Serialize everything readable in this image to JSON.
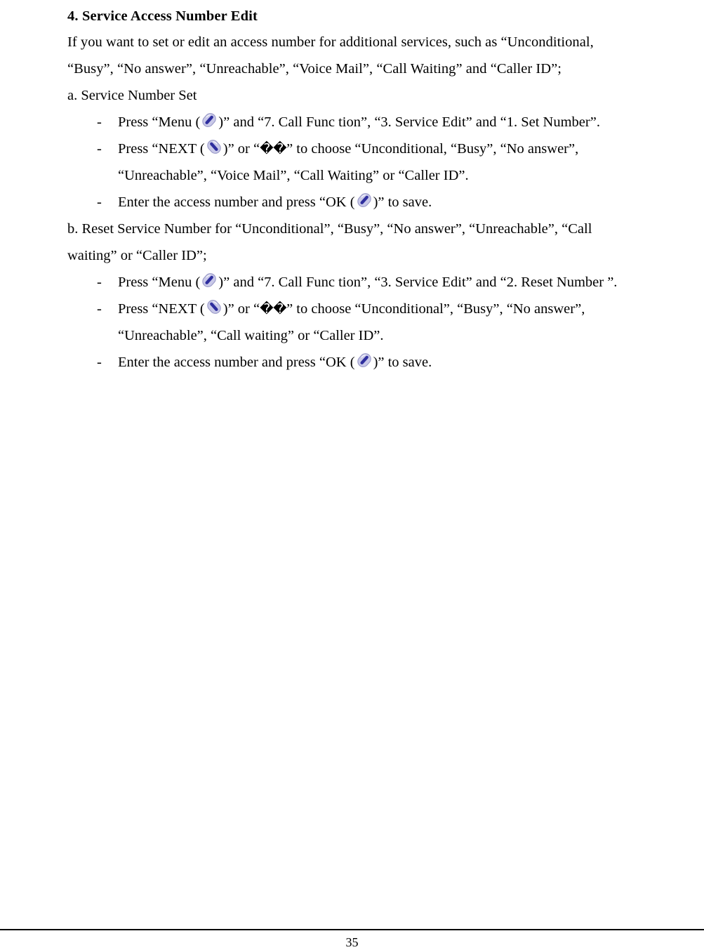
{
  "document": {
    "heading": "4. Service Access Number Edit",
    "intro": {
      "line1": "If you want to set or edit an access number for additional services, such as  “Unconditional,",
      "line2": "“Busy”, “No answer”, “Unreachable”, “Voice Mail”, “Call Waiting” and “Caller ID”;"
    },
    "section_a": {
      "subhead": "a. Service Number Set",
      "items": [
        {
          "dash": "-",
          "before_icon": "Press “Menu (",
          "icon": "softkey-left-icon",
          "after_icon": ")” and “7. Call Func tion”, “3. Service Edit” and “1. Set Number”."
        },
        {
          "dash": "-",
          "before_icon": "Press “NEXT (",
          "icon": "softkey-right-icon",
          "after_icon": ")” or “",
          "missing_glyphs": "��",
          "after_glyphs": "” to choose  “Unconditional, “Busy”, “No answer”,",
          "continuation": "“Unreachable”, “Voice Mail”, “Call Waiting” or “Caller ID”."
        },
        {
          "dash": "-",
          "before_icon": "Enter the access number and press “OK (",
          "icon": "softkey-left-icon",
          "after_icon": ")” to save."
        }
      ]
    },
    "section_b": {
      "subhead_line1": "b. Reset Service Number for “Unconditional”, “Busy”, “No answer”, “Unreachable”, “Call",
      "subhead_line2": "waiting”  or “Caller ID”;",
      "items": [
        {
          "dash": "-",
          "before_icon": "Press “Menu (",
          "icon": "softkey-left-icon",
          "after_icon": ")” and “7. Call Func tion”, “3. Service Edit” and “2. Reset Number ”."
        },
        {
          "dash": "-",
          "before_icon": "Press “NEXT (",
          "icon": "softkey-right-icon",
          "after_icon": ")” or “",
          "missing_glyphs": "��",
          "after_glyphs": "” to choose  “Unconditional”, “Busy”, “No answer”,",
          "continuation": "“Unreachable”,  “Call waiting” or “Caller ID”."
        },
        {
          "dash": "-",
          "before_icon": "Enter the access number and press “OK (",
          "icon": "softkey-left-icon",
          "after_icon": ")” to save."
        }
      ]
    },
    "footer": {
      "page_number": "35"
    },
    "colors": {
      "text": "#000000",
      "icon_body": "#c9c9e8",
      "icon_stroke": "#2e2e9e",
      "icon_outline": "#9a9ac8",
      "rule": "#000000"
    }
  }
}
